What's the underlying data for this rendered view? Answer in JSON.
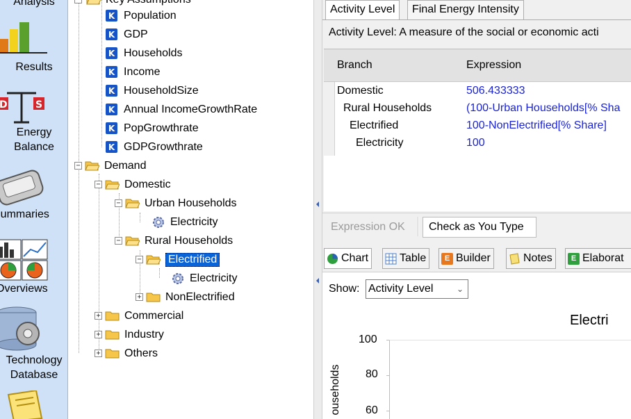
{
  "leftbar": {
    "items": [
      {
        "label_lines": [
          "Analysis"
        ],
        "icon": "analysis-icon"
      },
      {
        "label_lines": [
          "Results"
        ],
        "icon": "bar-chart-icon"
      },
      {
        "label_lines": [
          "Energy",
          "Balance"
        ],
        "icon": "balance-scale-icon"
      },
      {
        "label_lines": [
          "Summaries"
        ],
        "icon": "summaries-icon"
      },
      {
        "label_lines": [
          "Overviews"
        ],
        "icon": "overviews-icon"
      },
      {
        "label_lines": [
          "Technology",
          "Database"
        ],
        "icon": "database-gear-icon"
      },
      {
        "label_lines": [
          ""
        ],
        "icon": "notes-icon"
      }
    ]
  },
  "tree": {
    "top_partial_label": "Key Assumptions",
    "key_assumptions": [
      "Population",
      "GDP",
      "Households",
      "Income",
      "HouseholdSize",
      "Annual IncomeGrowthRate",
      "PopGrowthrate",
      "GDPGrowthrate"
    ],
    "demand": "Demand",
    "domestic": "Domestic",
    "urban": "Urban Households",
    "urban_electricity": "Electricity",
    "rural": "Rural Households",
    "electrified": "Electrified",
    "electrified_electricity": "Electricity",
    "nonelectrified": "NonElectrified",
    "commercial": "Commercial",
    "industry": "Industry",
    "others": "Others"
  },
  "right": {
    "tabs": [
      "Activity Level",
      "Final Energy Intensity"
    ],
    "description": "Activity Level: A measure of the social or economic acti",
    "grid": {
      "headers": [
        "Branch",
        "Expression"
      ],
      "rows": [
        {
          "branch": "Domestic",
          "expression": "506.433333"
        },
        {
          "branch": "Rural Households",
          "expression": "(100-Urban Households[% Sha"
        },
        {
          "branch": "Electrified",
          "expression": "100-NonElectrified[% Share]"
        },
        {
          "branch": "Electricity",
          "expression": "100"
        }
      ]
    },
    "status": "Expression OK",
    "check_button": "Check as You Type",
    "bottom_tabs": [
      "Chart",
      "Table",
      "Builder",
      "Notes",
      "Elaborat"
    ],
    "show_label": "Show:",
    "show_value": "Activity Level",
    "chart_title": "Electri",
    "y_axis_label": "ouseholds",
    "y_ticks": [
      "100",
      "80",
      "60"
    ]
  }
}
